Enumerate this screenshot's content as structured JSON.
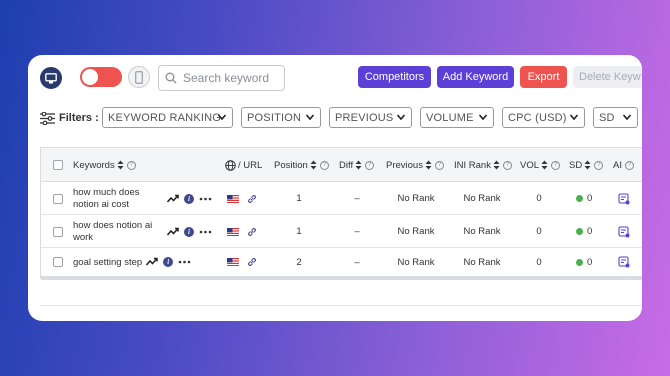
{
  "toolbar": {
    "search_placeholder": "Search keyword",
    "competitors_label": "Competitors",
    "add_keyword_label": "Add Keyword",
    "export_label": "Export",
    "delete_label": "Delete Keyw"
  },
  "filters": {
    "label": "Filters :",
    "items": [
      "KEYWORD RANKING",
      "POSITION",
      "PREVIOUS",
      "VOLUME",
      "CPC (USD)",
      "SD"
    ]
  },
  "table": {
    "headers": {
      "keywords": "Keywords",
      "url": "/ URL",
      "position": "Position",
      "diff": "Diff",
      "previous": "Previous",
      "ini_rank": "INI Rank",
      "vol": "VOL",
      "sd": "SD",
      "ai": "AI"
    },
    "rows": [
      {
        "keyword": "how much does notion ai cost",
        "position": "1",
        "diff": "–",
        "previous": "No Rank",
        "ini_rank": "No Rank",
        "vol": "0",
        "sd": "0"
      },
      {
        "keyword": "how does notion ai work",
        "position": "1",
        "diff": "–",
        "previous": "No Rank",
        "ini_rank": "No Rank",
        "vol": "0",
        "sd": "0"
      },
      {
        "keyword": "goal setting step",
        "position": "2",
        "diff": "–",
        "previous": "No Rank",
        "ini_rank": "No Rank",
        "vol": "0",
        "sd": "0"
      }
    ]
  },
  "colors": {
    "primary": "#5b3fd6",
    "danger": "#ef5350",
    "success": "#4caf50"
  }
}
